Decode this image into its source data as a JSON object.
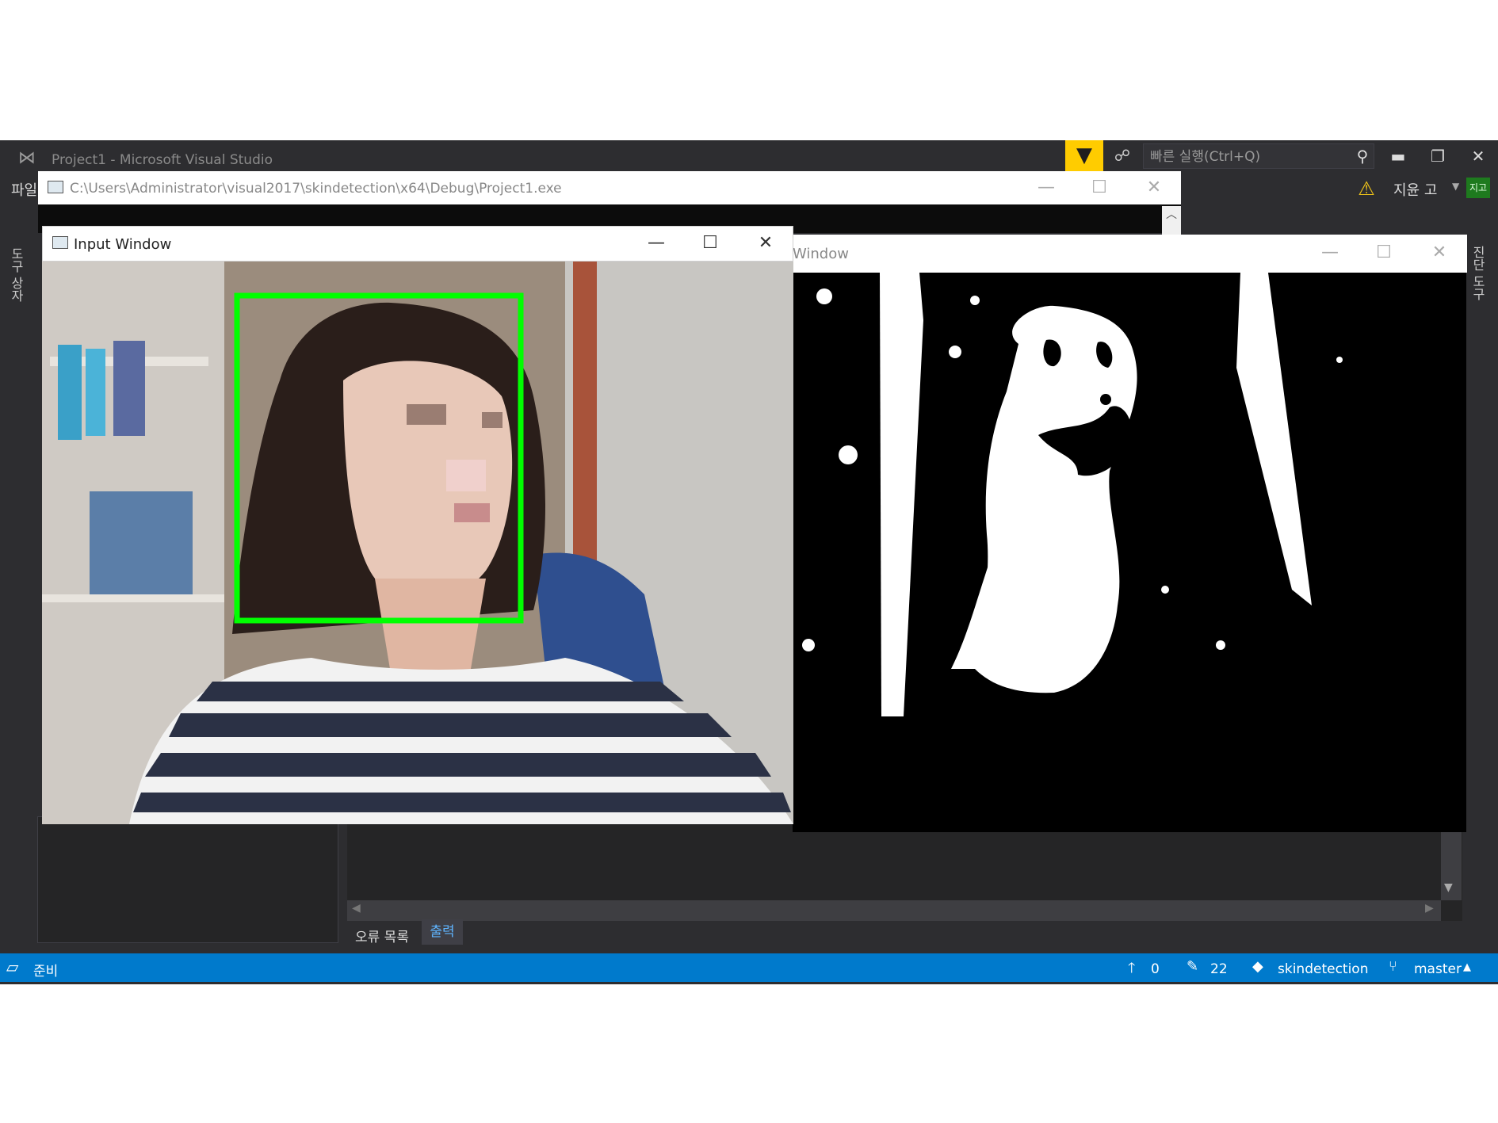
{
  "vs": {
    "title": "Project1 - Microsoft Visual Studio",
    "quick_launch_placeholder": "빠른 실행(Ctrl+Q)",
    "menu_partial": "파일",
    "user_name": "지윤 고",
    "user_avatar": "지고",
    "left_tab": "도구 상자",
    "right_tab": "진단 도구",
    "bottom_tabs": {
      "errors": "오류 목록",
      "output": "출력"
    },
    "icons": {
      "logo": "visual-studio-icon",
      "filter": "filter-icon",
      "feedback": "feedback-icon",
      "search": "search-icon",
      "warning": "warning-icon"
    }
  },
  "statusbar": {
    "ready": "준비",
    "up_count": "0",
    "changes_count": "22",
    "repo": "skindetection",
    "branch": "master"
  },
  "console": {
    "title": "C:\\Users\\Administrator\\visual2017\\skindetection\\x64\\Debug\\Project1.exe"
  },
  "input_window": {
    "title": "Input Window"
  },
  "output_window": {
    "title": "Window"
  },
  "colors": {
    "vs_chrome": "#2d2d30",
    "statusbar": "#007acc",
    "face_box": "#00ff00",
    "filter_button": "#ffcc00"
  }
}
